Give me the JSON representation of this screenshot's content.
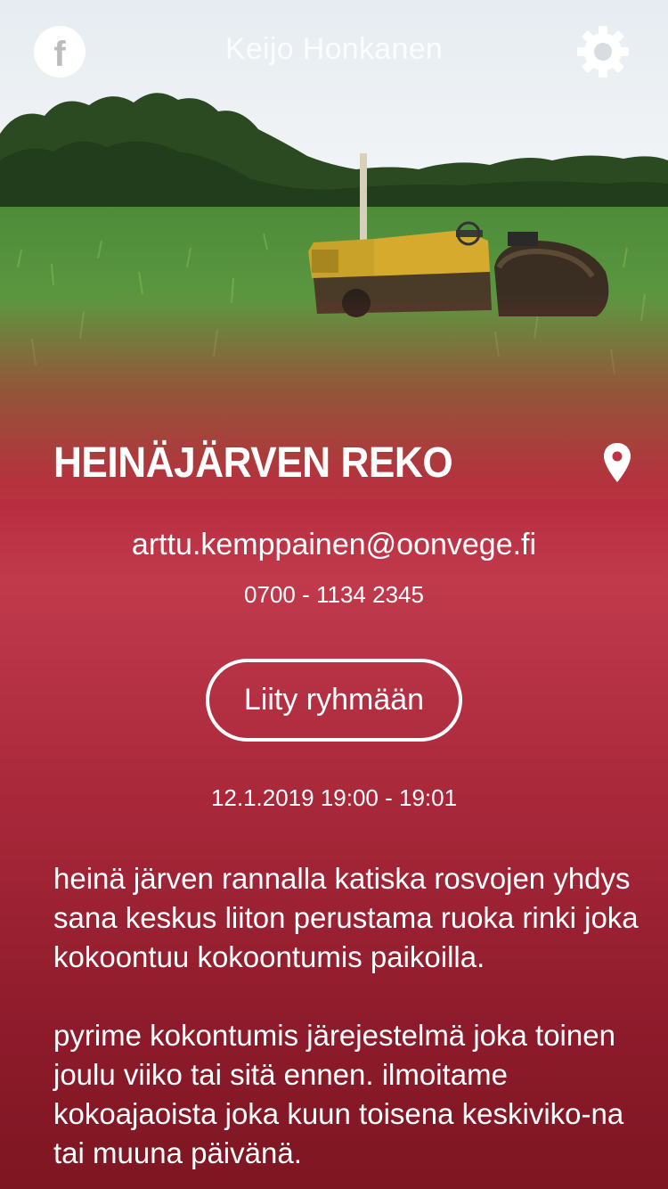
{
  "header": {
    "user_name": "Keijo Honkanen",
    "facebook_icon": "facebook-icon",
    "settings_icon": "gear-icon"
  },
  "group": {
    "title": "HEINÄJÄRVEN REKO",
    "location_icon": "location-pin-icon",
    "email": "arttu.kemppainen@oonvege.fi",
    "phone": "0700 - 1134 2345",
    "join_label": "Liity ryhmään",
    "event_time": "12.1.2019 19:00 - 19:01",
    "description": [
      "heinä järven rannalla katiska rosvojen yhdys sana keskus liiton perustama ruoka rinki joka kokoontuu kokoontumis paikoilla.",
      "pyrime kokontumis järejestelmä joka toinen joulu viiko tai sitä ennen. ilmoitame kokoajaoista joka kuun toisena keskiviko-na tai muuna päivänä."
    ]
  },
  "colors": {
    "accent_red": "#c03a4c",
    "deep_red": "#7e1622",
    "text": "#ffffff"
  }
}
